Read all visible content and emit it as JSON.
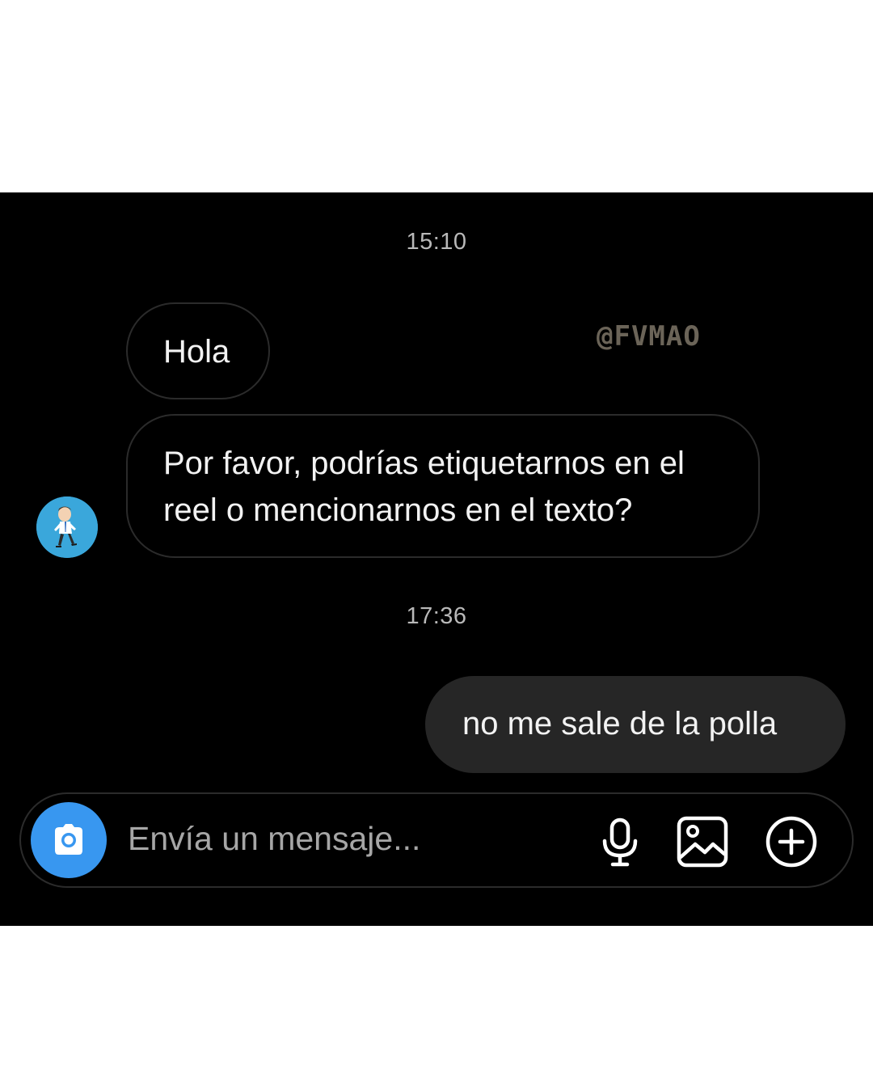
{
  "conversation": {
    "timestamps": [
      "15:10",
      "17:36"
    ],
    "watermark": "@FVMAO",
    "messages": [
      {
        "sender": "them",
        "text": "Hola"
      },
      {
        "sender": "them",
        "text": "Por favor, podrías etiquetarnos en el reel o mencionarnos en el texto?"
      },
      {
        "sender": "me",
        "text": "no me sale de la polla"
      }
    ]
  },
  "composer": {
    "placeholder": "Envía un mensaje...",
    "icons": [
      "camera-icon",
      "microphone-icon",
      "gallery-icon",
      "plus-circle-icon"
    ]
  },
  "colors": {
    "background": "#000000",
    "accent": "#3897f0",
    "outgoing_bubble": "#262626",
    "avatar": "#3aa7db"
  }
}
